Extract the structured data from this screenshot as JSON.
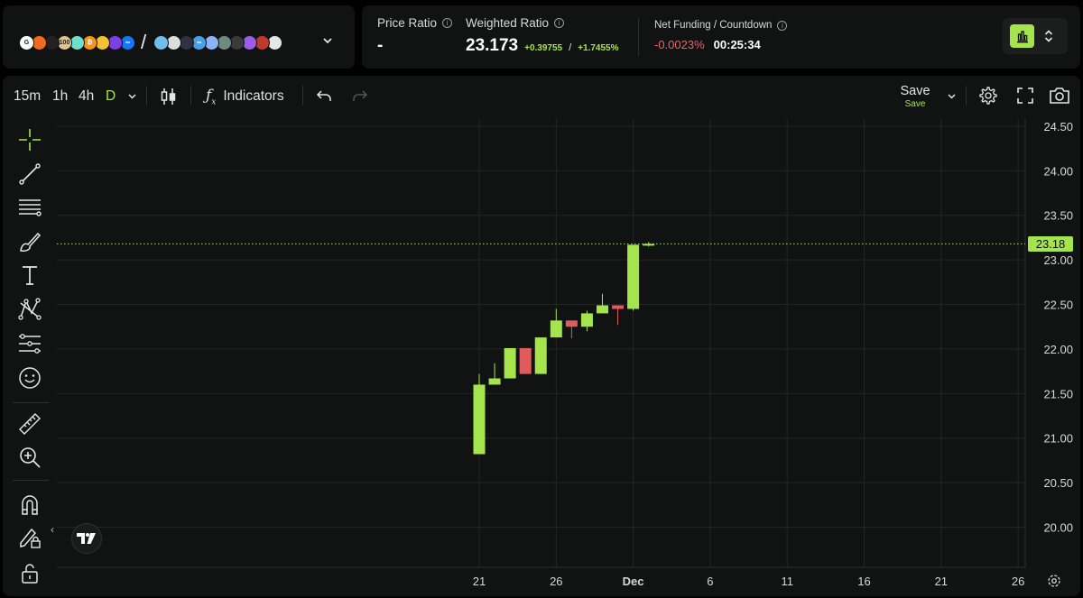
{
  "basket": {
    "slash": "/",
    "coins_left": [
      {
        "icon": "google-icon",
        "color": "#ffffff",
        "text": "G"
      },
      {
        "icon": "amazon-icon",
        "color": "#f06a1f",
        "text": ""
      },
      {
        "icon": "apple-icon",
        "color": "#222222",
        "text": ""
      },
      {
        "icon": "index-100-icon",
        "color": "#e2c48a",
        "text": "100"
      },
      {
        "icon": "bowtie-icon",
        "color": "#6ee0d0",
        "text": ""
      },
      {
        "icon": "bitcoin-icon",
        "color": "#f7931a",
        "text": "₿"
      },
      {
        "icon": "ring-icon",
        "color": "#f1c232",
        "text": ""
      },
      {
        "icon": "polygon-icon",
        "color": "#7b3fe4",
        "text": ""
      },
      {
        "icon": "meta-icon",
        "color": "#1877f2",
        "text": "∞"
      }
    ],
    "coins_right": [
      {
        "icon": "sui-icon",
        "color": "#6fbcf0",
        "text": ""
      },
      {
        "icon": "stripes-icon",
        "color": "#dddddd",
        "text": ""
      },
      {
        "icon": "cosmos-icon",
        "color": "#2e3148",
        "text": ""
      },
      {
        "icon": "lens-icon",
        "color": "#4aa0e6",
        "text": "∞"
      },
      {
        "icon": "drop-icon",
        "color": "#8ab4f8",
        "text": ""
      },
      {
        "icon": "moon-icon",
        "color": "#6e8a84",
        "text": ""
      },
      {
        "icon": "dot-icon",
        "color": "#3a3a3a",
        "text": ""
      },
      {
        "icon": "spiral-icon",
        "color": "#9b5de5",
        "text": ""
      },
      {
        "icon": "badge-icon",
        "color": "#c0392b",
        "text": ""
      },
      {
        "icon": "arrow-icon",
        "color": "#e6e6e6",
        "text": ""
      }
    ]
  },
  "stats": {
    "price_ratio_label": "Price Ratio",
    "price_ratio_value": "-",
    "weighted_ratio_label": "Weighted Ratio",
    "weighted_ratio_value": "23.173",
    "change_abs": "+0.39755",
    "change_sep": "/",
    "change_pct": "+1.7455%",
    "net_funding_label": "Net Funding / Countdown",
    "net_funding_value": "-0.0023%",
    "countdown": "00:25:34"
  },
  "toolbar": {
    "intervals": [
      "15m",
      "1h",
      "4h",
      "D"
    ],
    "active_interval": "D",
    "indicators_label": "Indicators",
    "save_label": "Save",
    "save_sub_label": "Save"
  },
  "left_tools": [
    "crosshair-icon",
    "trend-line-icon",
    "fib-lines-icon",
    "brush-icon",
    "text-icon",
    "pattern-icon",
    "prediction-icon",
    "emoji-icon",
    "ruler-icon",
    "zoom-in-icon",
    "magnet-icon",
    "lock-draw-icon",
    "unlock-icon"
  ],
  "colors": {
    "accent": "#a6e44e",
    "down": "#e05c5c",
    "negative_text": "#f06060"
  },
  "chart_data": {
    "type": "candlestick",
    "x_ticks": [
      "21",
      "26",
      "Dec",
      "6",
      "11",
      "16",
      "21",
      "26"
    ],
    "y_ticks": [
      "24.50",
      "24.00",
      "23.50",
      "23.00",
      "22.50",
      "22.00",
      "21.50",
      "21.00",
      "20.50",
      "20.00"
    ],
    "ylim": [
      19.55,
      24.56
    ],
    "last_price": "23.18",
    "candles": [
      {
        "date": "Nov 21",
        "o": 20.82,
        "h": 21.72,
        "l": 20.82,
        "c": 21.6
      },
      {
        "date": "Nov 22",
        "o": 21.6,
        "h": 21.84,
        "l": 21.6,
        "c": 21.67
      },
      {
        "date": "Nov 23",
        "o": 21.67,
        "h": 22.01,
        "l": 21.67,
        "c": 22.01
      },
      {
        "date": "Nov 24",
        "o": 22.01,
        "h": 22.01,
        "l": 21.72,
        "c": 21.72
      },
      {
        "date": "Nov 25",
        "o": 21.72,
        "h": 22.13,
        "l": 21.72,
        "c": 22.13
      },
      {
        "date": "Nov 26",
        "o": 22.13,
        "h": 22.45,
        "l": 22.13,
        "c": 22.32
      },
      {
        "date": "Nov 27",
        "o": 22.32,
        "h": 22.32,
        "l": 22.12,
        "c": 22.25
      },
      {
        "date": "Nov 28",
        "o": 22.25,
        "h": 22.43,
        "l": 22.2,
        "c": 22.4
      },
      {
        "date": "Nov 29",
        "o": 22.4,
        "h": 22.62,
        "l": 22.4,
        "c": 22.49
      },
      {
        "date": "Nov 30",
        "o": 22.49,
        "h": 22.49,
        "l": 22.27,
        "c": 22.45
      },
      {
        "date": "Dec 1",
        "o": 22.45,
        "h": 23.17,
        "l": 22.43,
        "c": 23.17
      },
      {
        "date": "Dec 2",
        "o": 23.16,
        "h": 23.2,
        "l": 23.15,
        "c": 23.18
      }
    ]
  }
}
